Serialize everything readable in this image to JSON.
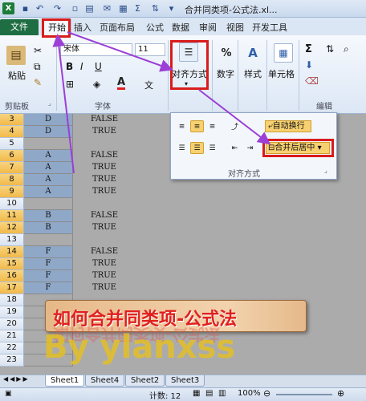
{
  "window": {
    "title": "合并同类项-公式法.xl...",
    "quick_access": [
      "save-icon",
      "undo-icon",
      "redo-icon",
      "new-icon",
      "open-icon",
      "email-icon",
      "table-icon",
      "sum-icon",
      "sort-icon"
    ]
  },
  "tabs": {
    "file": "文件",
    "items": [
      "开始",
      "插入",
      "页面布局",
      "公式",
      "数据",
      "审阅",
      "视图",
      "开发工具"
    ]
  },
  "ribbon": {
    "clipboard": {
      "paste": "粘贴",
      "label": "剪贴板"
    },
    "font": {
      "name": "宋体",
      "size": "11",
      "label": "字体",
      "bold": "B",
      "italic": "I",
      "underline": "U",
      "font_color_glyph": "A"
    },
    "alignment": {
      "button_label": "对齐方式"
    },
    "number": {
      "button_label": "数字",
      "percent": "%"
    },
    "styles": {
      "button_label": "样式"
    },
    "cells": {
      "button_label": "单元格"
    },
    "editing": {
      "label": "编辑"
    }
  },
  "popup": {
    "wrap_text": "自动换行",
    "merge_center": "合并后居中",
    "group_label": "对齐方式"
  },
  "rows": [
    {
      "num": "3",
      "a": "D",
      "b": "FALSE",
      "fill": true,
      "selected": true
    },
    {
      "num": "4",
      "a": "D",
      "b": "TRUE",
      "fill": true,
      "selected": true
    },
    {
      "num": "5",
      "a": "",
      "b": "",
      "fill": false,
      "selected": false
    },
    {
      "num": "6",
      "a": "A",
      "b": "FALSE",
      "fill": true,
      "selected": true
    },
    {
      "num": "7",
      "a": "A",
      "b": "TRUE",
      "fill": true,
      "selected": true
    },
    {
      "num": "8",
      "a": "A",
      "b": "TRUE",
      "fill": true,
      "selected": true
    },
    {
      "num": "9",
      "a": "A",
      "b": "TRUE",
      "fill": true,
      "selected": true
    },
    {
      "num": "10",
      "a": "",
      "b": "",
      "fill": false,
      "selected": false
    },
    {
      "num": "11",
      "a": "B",
      "b": "FALSE",
      "fill": true,
      "selected": true
    },
    {
      "num": "12",
      "a": "B",
      "b": "TRUE",
      "fill": true,
      "selected": true
    },
    {
      "num": "13",
      "a": "",
      "b": "",
      "fill": false,
      "selected": false
    },
    {
      "num": "14",
      "a": "F",
      "b": "FALSE",
      "fill": true,
      "selected": true
    },
    {
      "num": "15",
      "a": "F",
      "b": "TRUE",
      "fill": true,
      "selected": true
    },
    {
      "num": "16",
      "a": "F",
      "b": "TRUE",
      "fill": true,
      "selected": true
    },
    {
      "num": "17",
      "a": "F",
      "b": "TRUE",
      "fill": true,
      "selected": true
    },
    {
      "num": "18",
      "a": "",
      "b": "",
      "fill": false,
      "selected": false
    },
    {
      "num": "19",
      "a": "",
      "b": "",
      "fill": false,
      "selected": false
    },
    {
      "num": "20",
      "a": "",
      "b": "",
      "fill": false,
      "selected": false
    },
    {
      "num": "21",
      "a": "",
      "b": "",
      "fill": false,
      "selected": false
    },
    {
      "num": "22",
      "a": "",
      "b": "",
      "fill": false,
      "selected": false
    },
    {
      "num": "23",
      "a": "",
      "b": "",
      "fill": false,
      "selected": false
    }
  ],
  "banner": {
    "text": "如何合并同类项-公式法",
    "reflection": "如何合并同类项-公式法"
  },
  "watermark": "By  ylanxss",
  "sheet_tabs": [
    "Sheet1",
    "Sheet4",
    "Sheet2",
    "Sheet3"
  ],
  "status": {
    "count": "计数: 12",
    "zoom": "100%"
  },
  "colors": {
    "accent_red": "#d81c1c",
    "arrow_purple": "#9b3fd6",
    "file_tab": "#1f6e43",
    "cell_fill": "#8fa8c8"
  }
}
